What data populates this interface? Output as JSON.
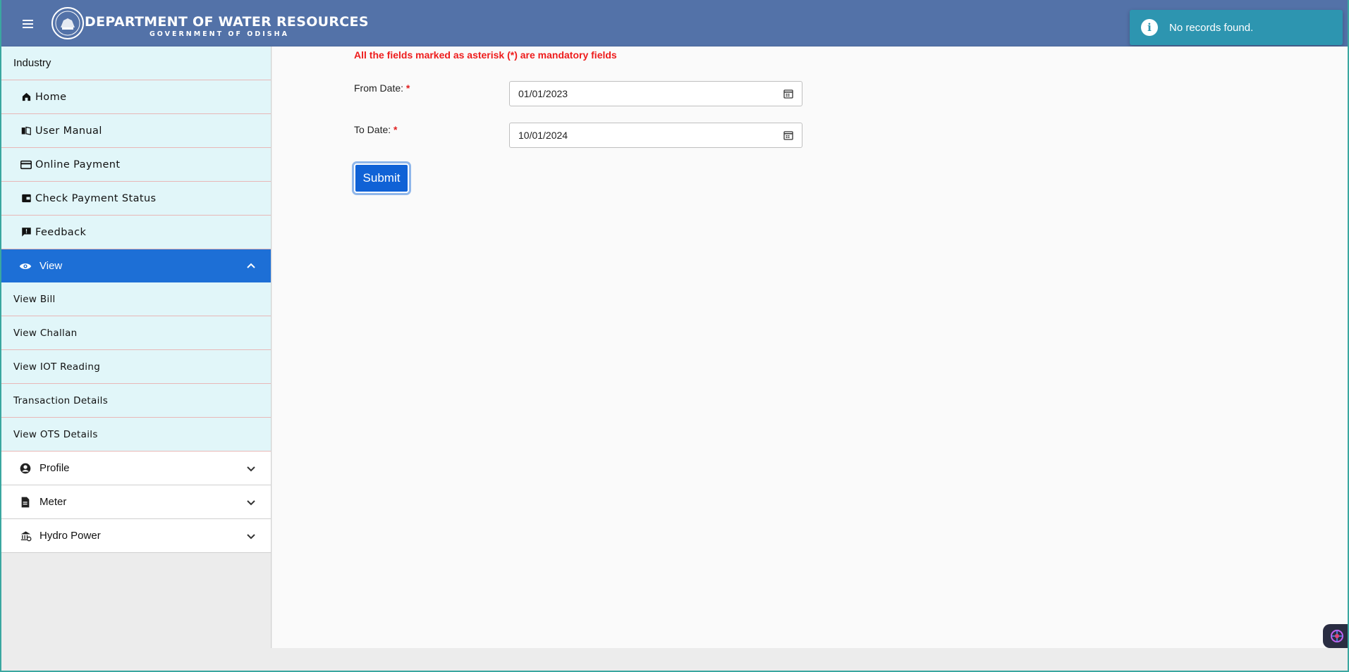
{
  "header": {
    "title": "DEPARTMENT OF WATER RESOURCES",
    "subtitle": "GOVERNMENT OF ODISHA",
    "menu_icon": "hamburger-menu-icon",
    "logo_icon": "state-emblem-icon"
  },
  "toast": {
    "message": "No records found.",
    "icon": "info-icon",
    "color": "#2d95b0"
  },
  "sidebar": {
    "section_label": "Industry",
    "items": [
      {
        "label": "Home",
        "icon": "home-icon"
      },
      {
        "label": "User Manual",
        "icon": "book-icon"
      },
      {
        "label": "Online Payment",
        "icon": "credit-card-icon"
      },
      {
        "label": "Check Payment Status",
        "icon": "wallet-icon"
      },
      {
        "label": "Feedback",
        "icon": "feedback-icon"
      }
    ],
    "view_group": {
      "label": "View",
      "icon": "eye-icon",
      "expanded": true,
      "children": [
        "View Bill",
        "View Challan",
        "View IOT Reading",
        "Transaction Details",
        "View OTS Details"
      ]
    },
    "groups": [
      {
        "label": "Profile",
        "icon": "user-circle-icon"
      },
      {
        "label": "Meter",
        "icon": "document-icon"
      },
      {
        "label": "Hydro Power",
        "icon": "bank-icon"
      }
    ]
  },
  "form": {
    "mandatory_note": "All the fields marked as asterisk (*) are mandatory fields",
    "from_label": "From Date:",
    "from_value": "01/01/2023",
    "to_label": "To Date:",
    "to_value": "10/01/2024",
    "required_mark": "*",
    "submit_label": "Submit"
  },
  "colors": {
    "header": "#5372a8",
    "active": "#1d6fd6",
    "submit": "#1062d6",
    "mandatory": "#ee1c1c",
    "sidebar_bg": "#e1f6f9"
  }
}
